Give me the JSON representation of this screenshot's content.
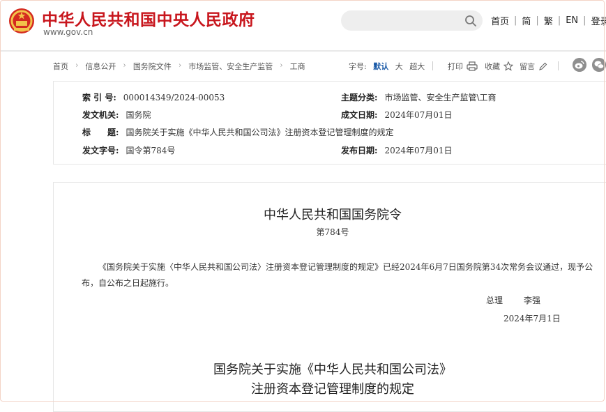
{
  "header": {
    "site_title": "中华人民共和国中央人民政府",
    "site_url": "www.gov.cn",
    "search_placeholder": "",
    "nav": [
      "首页",
      "简",
      "繁",
      "EN",
      "登录"
    ]
  },
  "breadcrumb": {
    "items": [
      "首页",
      "信息公开",
      "国务院文件",
      "市场监管、安全生产监管",
      "工商"
    ]
  },
  "font_size": {
    "label": "字号:",
    "options": [
      "默认",
      "大",
      "超大"
    ],
    "selected": "默认"
  },
  "tools": {
    "print": "打印",
    "favorite": "收藏",
    "comment": "留言"
  },
  "info": {
    "index_label": "索 引 号:",
    "index_value": "000014349/2024-00053",
    "category_label": "主题分类:",
    "category_value": "市场监管、安全生产监管\\工商",
    "issuer_label": "发文机关:",
    "issuer_value": "国务院",
    "created_label": "成文日期:",
    "created_value": "2024年07月01日",
    "title_label": "标　　题:",
    "title_value": "国务院关于实施《中华人民共和国公司法》注册资本登记管理制度的规定",
    "doc_no_label": "发文字号:",
    "doc_no_value": "国令第784号",
    "published_label": "发布日期:",
    "published_value": "2024年07月01日"
  },
  "article": {
    "order_title": "中华人民共和国国务院令",
    "order_number": "第784号",
    "paragraph": "《国务院关于实施〈中华人民共和国公司法〉注册资本登记管理制度的规定》已经2024年6月7日国务院第34次常务会议通过，现予公布，自公布之日起施行。",
    "signer_title": "总理",
    "signer_name": "李强",
    "sign_date": "2024年7月1日",
    "reg_title_line1": "国务院关于实施《中华人民共和国公司法》",
    "reg_title_line2": "注册资本登记管理制度的规定"
  },
  "colors": {
    "brand_red": "#c8161d",
    "link_blue": "#1a5aa8"
  },
  "icons": [
    "national-emblem-icon",
    "search-icon",
    "printer-icon",
    "star-icon",
    "pencil-icon",
    "weibo-icon",
    "wechat-icon"
  ]
}
